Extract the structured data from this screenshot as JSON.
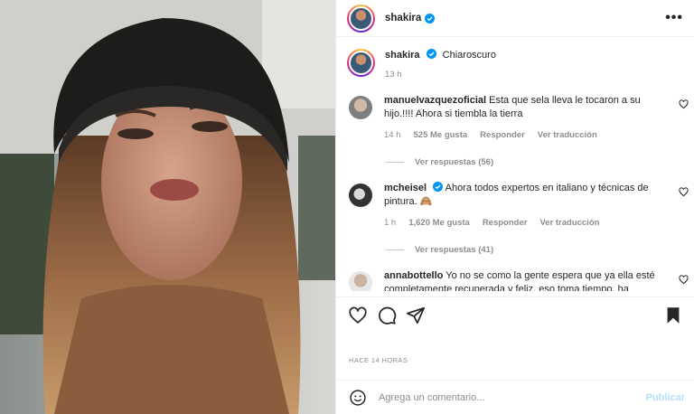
{
  "post": {
    "author": "shakira",
    "caption_text": "Chiaroscuro",
    "caption_time": "13 h",
    "more_label": "•••"
  },
  "comments": [
    {
      "user": "manuelvazquezoficial",
      "verified": false,
      "text": "Esta que sela lleva le tocaron a su hijo.!!!! Ahora si tiembla la tierra",
      "time": "14 h",
      "likes": "525 Me gusta",
      "reply": "Responder",
      "translate": "Ver traducción",
      "replies": "Ver respuestas (56)"
    },
    {
      "user": "mcheisel",
      "verified": true,
      "text": "Ahora todos expertos en italiano y técnicas de pintura. 🙈",
      "time": "1 h",
      "likes": "1,620 Me gusta",
      "reply": "Responder",
      "translate": "Ver traducción",
      "replies": "Ver respuestas (41)"
    },
    {
      "user": "annabottello",
      "verified": false,
      "text": "Yo no se como la gente espera que ya ella esté completamente recuperada y feliz, eso toma tiempo, ha vivido"
    }
  ],
  "footer": {
    "time_ago": "HACE 14 HORAS",
    "comment_placeholder": "Agrega un comentario...",
    "publish_label": "Publicar"
  },
  "icons": {
    "like": "heart-icon",
    "comment": "comment-icon",
    "share": "share-icon",
    "save": "bookmark-icon",
    "emoji": "emoji-icon",
    "verified": "verified-badge-icon"
  },
  "colors": {
    "verified": "#0095f6",
    "publish_disabled": "#b2dffc",
    "muted": "#8e8e8e"
  }
}
